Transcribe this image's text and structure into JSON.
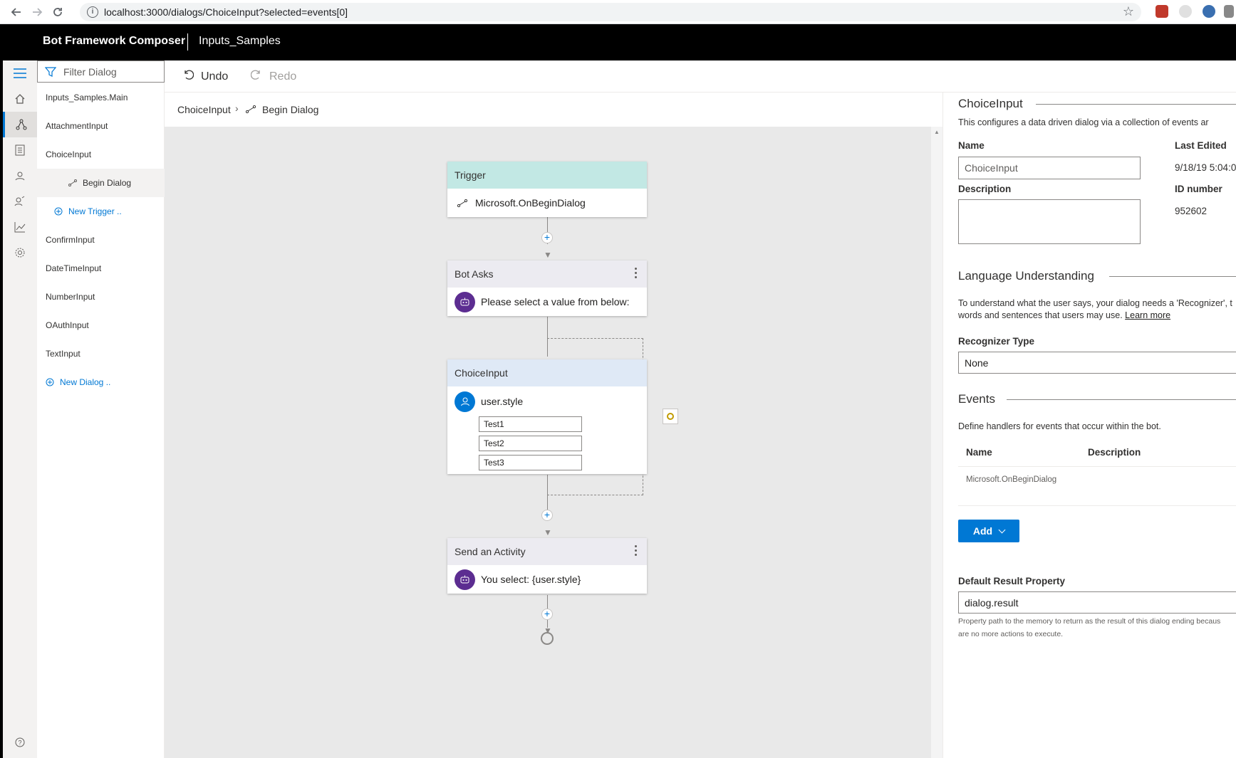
{
  "browser": {
    "url": "localhost:3000/dialogs/ChoiceInput?selected=events[0]"
  },
  "app": {
    "brand": "Bot Framework Composer",
    "project": "Inputs_Samples"
  },
  "dialog_list": {
    "filter_placeholder": "Filter Dialog",
    "items": [
      {
        "label": "Inputs_Samples.Main"
      },
      {
        "label": "AttachmentInput"
      },
      {
        "label": "ChoiceInput"
      },
      {
        "label": "Begin Dialog"
      },
      {
        "label": "New Trigger .."
      },
      {
        "label": "ConfirmInput"
      },
      {
        "label": "DateTimeInput"
      },
      {
        "label": "NumberInput"
      },
      {
        "label": "OAuthInput"
      },
      {
        "label": "TextInput"
      },
      {
        "label": "New Dialog .."
      }
    ]
  },
  "toolbar": {
    "undo": "Undo",
    "redo": "Redo"
  },
  "breadcrumb": {
    "first": "ChoiceInput",
    "second": "Begin Dialog"
  },
  "flow": {
    "trigger": {
      "title": "Trigger",
      "event": "Microsoft.OnBeginDialog"
    },
    "bot_asks": {
      "title": "Bot Asks",
      "text": "Please select a value from below:"
    },
    "choice_input": {
      "title": "ChoiceInput",
      "property": "user.style",
      "choices": [
        "Test1",
        "Test2",
        "Test3"
      ]
    },
    "send_activity": {
      "title": "Send an Activity",
      "text": "You select: {user.style}"
    }
  },
  "properties": {
    "title": "ChoiceInput",
    "description_text": "This configures a data driven dialog via a collection of events ar",
    "name_label": "Name",
    "name_value": "ChoiceInput",
    "last_edited_label": "Last Edited",
    "last_edited_value": "9/18/19 5:04:0",
    "description_label": "Description",
    "id_label": "ID number",
    "id_value": "952602",
    "lu_title": "Language Understanding",
    "lu_text_1": "To understand what the user says, your dialog needs a 'Recognizer', t",
    "lu_text_2": "words and sentences that users may use.",
    "learn_more": "Learn more",
    "recognizer_label": "Recognizer Type",
    "recognizer_value": "None",
    "events_title": "Events",
    "events_text": "Define handlers for events that occur within the bot.",
    "events_col_name": "Name",
    "events_col_desc": "Description",
    "events_row_name": "Microsoft.OnBeginDialog",
    "add_label": "Add",
    "default_result_label": "Default Result Property",
    "default_result_value": "dialog.result",
    "help_1": "Property path to the memory to return as the result of this dialog ending becaus",
    "help_2": "are no more actions to execute."
  },
  "colors": {
    "accent": "#0078d4",
    "bot_avatar": "#5c2d91",
    "trigger_header": "#c2e8e4",
    "action_header": "#ecebf1",
    "input_header": "#dfe9f6"
  }
}
